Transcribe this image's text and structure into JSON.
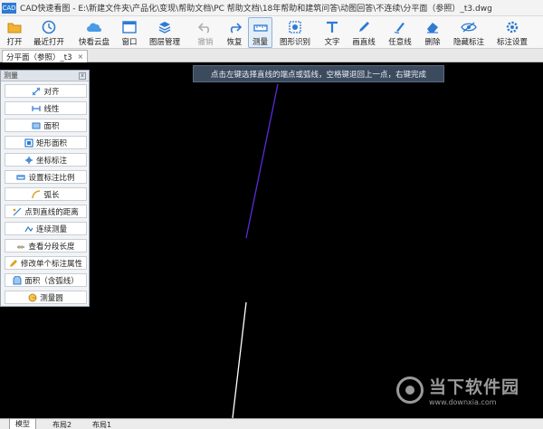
{
  "window": {
    "app_badge": "CAD",
    "title": "CAD快速看图 - E:\\新建文件夹\\产品化\\变现\\帮助文档\\PC 帮助文档\\18年帮助和建筑问答\\动图回答\\不连续\\分平面（参照）_t3.dwg"
  },
  "toolbar": {
    "items": [
      {
        "label": "打开",
        "icon": "folder-icon",
        "disabled": false
      },
      {
        "label": "最近打开",
        "icon": "clock-icon",
        "disabled": false
      },
      {
        "label": "快看云盘",
        "icon": "cloud-icon",
        "disabled": false
      },
      {
        "label": "窗口",
        "icon": "window-icon",
        "disabled": false
      },
      {
        "label": "图层管理",
        "icon": "layers-icon",
        "disabled": false
      },
      {
        "label": "撤销",
        "icon": "undo-icon",
        "disabled": true
      },
      {
        "label": "恢复",
        "icon": "redo-icon",
        "disabled": false
      },
      {
        "label": "测量",
        "icon": "ruler-icon",
        "disabled": false,
        "active": true
      },
      {
        "label": "图形识别",
        "icon": "shape-recognize-icon",
        "disabled": false
      },
      {
        "label": "文字",
        "icon": "text-icon",
        "disabled": false
      },
      {
        "label": "画直线",
        "icon": "pencil-icon",
        "disabled": false
      },
      {
        "label": "任意线",
        "icon": "freehand-icon",
        "disabled": false
      },
      {
        "label": "删除",
        "icon": "eraser-icon",
        "disabled": false
      },
      {
        "label": "隐藏标注",
        "icon": "eye-hide-icon",
        "disabled": false
      },
      {
        "label": "标注设置",
        "icon": "gear-icon",
        "disabled": false
      }
    ]
  },
  "doc_tab": {
    "label": "分平面（参照）_t3",
    "close": "×"
  },
  "hint": "点击左键选择直线的端点或弧线，空格键退回上一点，右键完成",
  "measure_panel": {
    "title": "测量",
    "close": "x",
    "items": [
      "对齐",
      "线性",
      "面积",
      "矩形面积",
      "坐标标注",
      "设置标注比例",
      "弧长",
      "点到直线的距离",
      "连续测量",
      "查看分段长度",
      "修改单个标注属性",
      "面积（含弧线）",
      "测量圆"
    ]
  },
  "layout_tabs": [
    "模型",
    "布局2",
    "布局1"
  ],
  "watermark": {
    "cn": "当下软件园",
    "en": "www.downxia.com"
  },
  "colors": {
    "canvas": "#000000",
    "purple_line": "#5b2bd8",
    "white_line": "#ffffff",
    "accent": "#2d7bd3"
  }
}
